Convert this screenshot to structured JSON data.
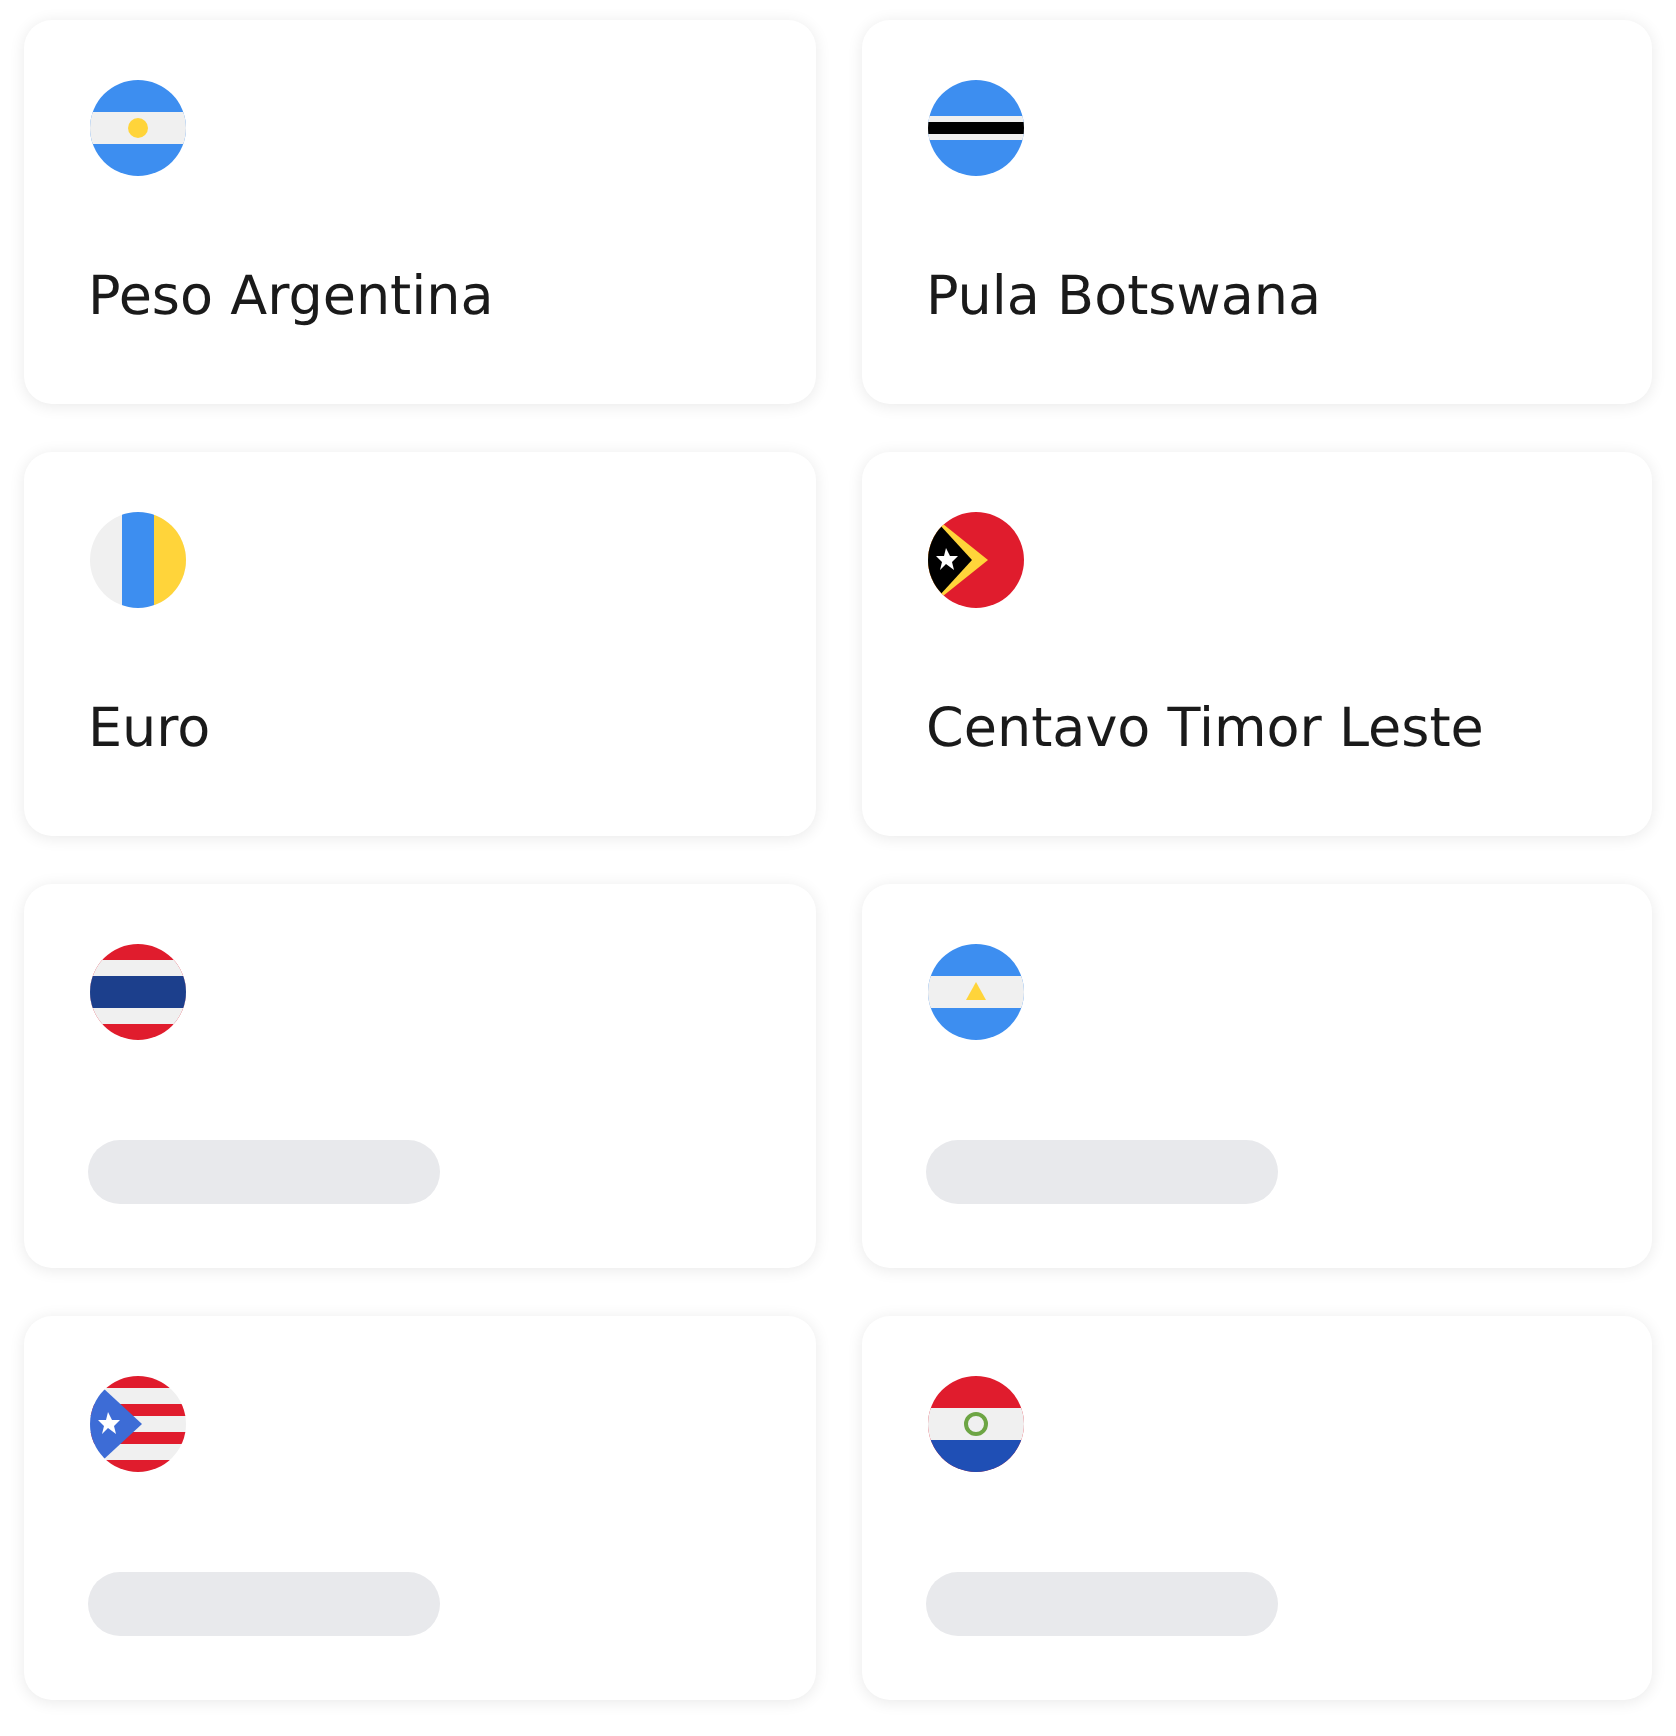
{
  "cards": [
    {
      "kind": "loaded",
      "label": "Peso Argentina"
    },
    {
      "kind": "loaded",
      "label": "Pula Botswana"
    },
    {
      "kind": "loaded",
      "label": "Euro"
    },
    {
      "kind": "loaded",
      "label": "Centavo Timor Leste"
    },
    {
      "kind": "loading"
    },
    {
      "kind": "loading"
    },
    {
      "kind": "loading"
    },
    {
      "kind": "loading"
    }
  ]
}
